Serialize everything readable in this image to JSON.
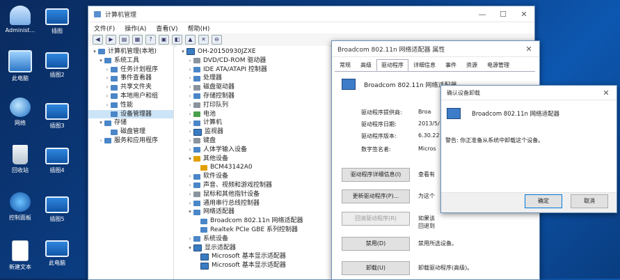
{
  "desktop": {
    "icons": [
      {
        "label": "Administ..."
      },
      {
        "label": "插图"
      },
      {
        "label": "此电脑"
      },
      {
        "label": "插图2"
      },
      {
        "label": "网络"
      },
      {
        "label": "插图3"
      },
      {
        "label": "回收站"
      },
      {
        "label": "插图4"
      },
      {
        "label": "控制面板"
      },
      {
        "label": "插图5"
      },
      {
        "label": "新建文本"
      },
      {
        "label": "此电脑"
      }
    ]
  },
  "computer_management": {
    "title": "计算机管理",
    "menu": [
      "文件(F)",
      "操作(A)",
      "查看(V)",
      "帮助(H)"
    ],
    "tree": [
      {
        "label": "计算机管理(本地)",
        "level": 0,
        "exp": "▾"
      },
      {
        "label": "系统工具",
        "level": 1,
        "exp": "▾"
      },
      {
        "label": "任务计划程序",
        "level": 2,
        "exp": "›"
      },
      {
        "label": "事件查看器",
        "level": 2,
        "exp": "›"
      },
      {
        "label": "共享文件夹",
        "level": 2,
        "exp": "›"
      },
      {
        "label": "本地用户和组",
        "level": 2,
        "exp": "›"
      },
      {
        "label": "性能",
        "level": 2,
        "exp": "›"
      },
      {
        "label": "设备管理器",
        "level": 2,
        "exp": "",
        "selected": true
      },
      {
        "label": "存储",
        "level": 1,
        "exp": "▾"
      },
      {
        "label": "磁盘管理",
        "level": 2,
        "exp": ""
      },
      {
        "label": "服务和应用程序",
        "level": 1,
        "exp": "›"
      }
    ],
    "devices": [
      {
        "label": "OH-20150930JZXE",
        "level": 0,
        "exp": "▾",
        "icon": "mon"
      },
      {
        "label": "DVD/CD-ROM 驱动器",
        "level": 1,
        "exp": "›",
        "icon": "gray"
      },
      {
        "label": "IDE ATA/ATAPI 控制器",
        "level": 1,
        "exp": "›",
        "icon": ""
      },
      {
        "label": "处理器",
        "level": 1,
        "exp": "›",
        "icon": ""
      },
      {
        "label": "磁盘驱动器",
        "level": 1,
        "exp": "›",
        "icon": "gray"
      },
      {
        "label": "存储控制器",
        "level": 1,
        "exp": "›",
        "icon": ""
      },
      {
        "label": "打印队列",
        "level": 1,
        "exp": "›",
        "icon": "gray"
      },
      {
        "label": "电池",
        "level": 1,
        "exp": "›",
        "icon": "green"
      },
      {
        "label": "计算机",
        "level": 1,
        "exp": "›",
        "icon": ""
      },
      {
        "label": "监视器",
        "level": 1,
        "exp": "›",
        "icon": "mon"
      },
      {
        "label": "键盘",
        "level": 1,
        "exp": "›",
        "icon": "gray"
      },
      {
        "label": "人体学输入设备",
        "level": 1,
        "exp": "›",
        "icon": ""
      },
      {
        "label": "其他设备",
        "level": 1,
        "exp": "▾",
        "icon": "warn"
      },
      {
        "label": "BCM43142A0",
        "level": 2,
        "exp": "",
        "icon": "warn"
      },
      {
        "label": "软件设备",
        "level": 1,
        "exp": "›",
        "icon": ""
      },
      {
        "label": "声音、视频和游戏控制器",
        "level": 1,
        "exp": "›",
        "icon": ""
      },
      {
        "label": "鼠标和其他指针设备",
        "level": 1,
        "exp": "›",
        "icon": "gray"
      },
      {
        "label": "通用串行总线控制器",
        "level": 1,
        "exp": "›",
        "icon": ""
      },
      {
        "label": "网络适配器",
        "level": 1,
        "exp": "▾",
        "icon": ""
      },
      {
        "label": "Broadcom 802.11n 网络适配器",
        "level": 2,
        "exp": "",
        "icon": ""
      },
      {
        "label": "Realtek PCIe GBE 系列控制器",
        "level": 2,
        "exp": "",
        "icon": ""
      },
      {
        "label": "系统设备",
        "level": 1,
        "exp": "›",
        "icon": ""
      },
      {
        "label": "显示适配器",
        "level": 1,
        "exp": "▾",
        "icon": "mon"
      },
      {
        "label": "Microsoft 基本显示适配器",
        "level": 2,
        "exp": "",
        "icon": "mon"
      },
      {
        "label": "Microsoft 基本显示适配器",
        "level": 2,
        "exp": "",
        "icon": "mon"
      }
    ]
  },
  "properties": {
    "title": "Broadcom 802.11n 网络适配器 属性",
    "tabs": [
      "常规",
      "高级",
      "驱动程序",
      "详细信息",
      "事件",
      "资源",
      "电源管理"
    ],
    "active_tab": 2,
    "device_name": "Broadcom 802.11n 网络适配器",
    "fields": [
      {
        "label": "驱动程序提供商:",
        "value": "Broa"
      },
      {
        "label": "驱动程序日期:",
        "value": "2013/5/"
      },
      {
        "label": "驱动程序版本:",
        "value": "6.30.22"
      },
      {
        "label": "数字签名者:",
        "value": "Micros"
      }
    ],
    "buttons": [
      {
        "label": "驱动程序详细信息(I)",
        "desc": "查看有",
        "disabled": false
      },
      {
        "label": "更新驱动程序(P)...",
        "desc": "为这个",
        "disabled": false
      },
      {
        "label": "回滚驱动程序(R)",
        "desc": "如果该\n回退到",
        "disabled": true
      },
      {
        "label": "禁用(D)",
        "desc": "禁用所选设备。",
        "disabled": false
      },
      {
        "label": "卸载(U)",
        "desc": "卸载驱动程序(高级)。",
        "disabled": false
      }
    ]
  },
  "confirm": {
    "title": "确认设备卸载",
    "device_name": "Broadcom 802.11n 网络适配器",
    "message": "警告: 你正准备从系统中卸载这个设备。",
    "ok": "确定",
    "cancel": "取消"
  }
}
